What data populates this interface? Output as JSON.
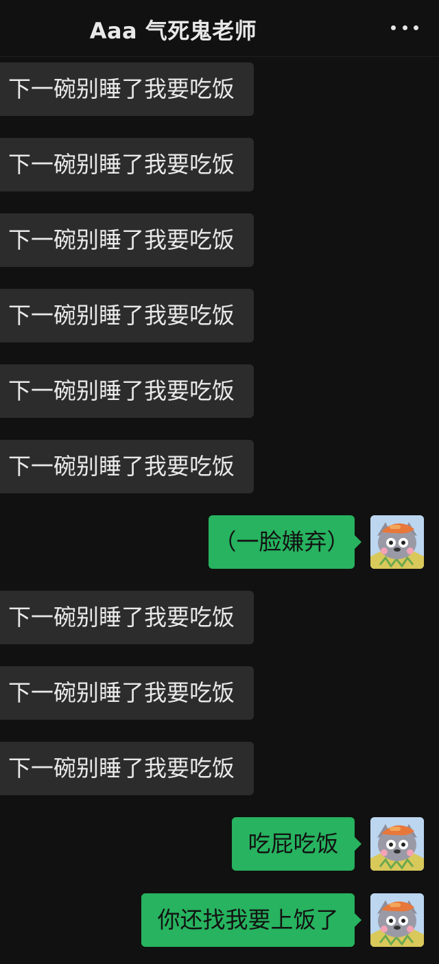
{
  "header": {
    "title": "Aaa 气死鬼老师",
    "more_icon": "more-dots-icon"
  },
  "messages": [
    {
      "side": "in",
      "text": "下一碗别睡了我要吃饭"
    },
    {
      "side": "in",
      "text": "下一碗别睡了我要吃饭"
    },
    {
      "side": "in",
      "text": "下一碗别睡了我要吃饭"
    },
    {
      "side": "in",
      "text": "下一碗别睡了我要吃饭"
    },
    {
      "side": "in",
      "text": "下一碗别睡了我要吃饭"
    },
    {
      "side": "in",
      "text": "下一碗别睡了我要吃饭"
    },
    {
      "side": "out",
      "text": "（一脸嫌弃）"
    },
    {
      "side": "in",
      "text": "下一碗别睡了我要吃饭"
    },
    {
      "side": "in",
      "text": "下一碗别睡了我要吃饭"
    },
    {
      "side": "in",
      "text": "下一碗别睡了我要吃饭"
    },
    {
      "side": "out",
      "text": "吃屁吃饭"
    },
    {
      "side": "out",
      "text": "你还找我要上饭了"
    }
  ],
  "colors": {
    "background": "#111111",
    "incoming_bubble": "#2c2c2c",
    "outgoing_bubble": "#27b35f"
  }
}
